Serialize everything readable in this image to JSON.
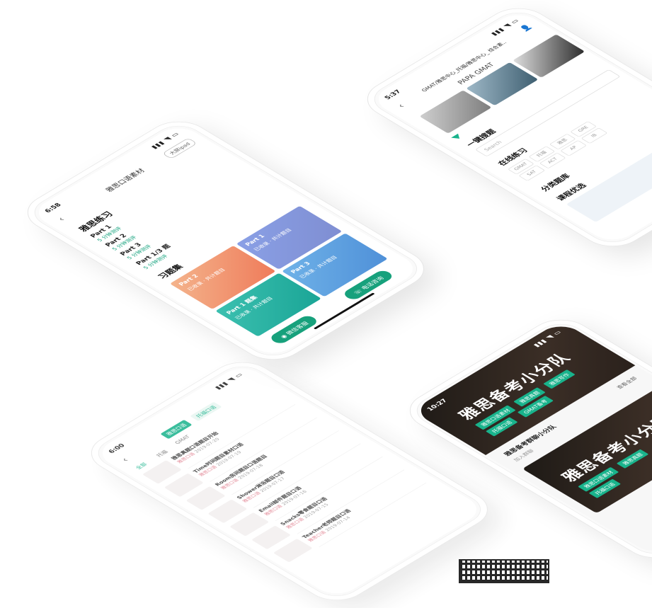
{
  "phone1": {
    "time": "6:58",
    "title": "雅思口语素材",
    "header_button": "大屏ipad",
    "section_title": "雅思练习",
    "parts": [
      {
        "name": "Part 1",
        "sub": "5 分钟测评"
      },
      {
        "name": "Part 2",
        "sub": "5 分钟测评"
      },
      {
        "name": "Part 3",
        "sub": "5 分钟测评"
      },
      {
        "name": "Part 1/3 题",
        "sub": "5 分钟测评"
      }
    ],
    "practice_title": "习题集",
    "tiles": [
      {
        "name": "Part 2",
        "desc": "已收录 · 共计题目"
      },
      {
        "name": "Part 1",
        "desc": "已收录 · 共计题目"
      },
      {
        "name": "Part 1 题集",
        "desc": "已收录 · 共计题目"
      },
      {
        "name": "Part 3",
        "desc": "已收录 · 共计题目"
      }
    ],
    "btn_left": "◉ 微信客服",
    "btn_right": "☏ 电话咨询"
  },
  "phone2": {
    "time": "5:37",
    "breadcrumb": "GMAT/雅思中心_托福/雅思中心_ 综合素..",
    "brand": "PAPA GMAT",
    "section1": "一键搜题",
    "search_placeholder": "Search",
    "section2": "在线练习",
    "chips": [
      "GMAT",
      "托福",
      "雅思",
      "GRE",
      "SAT",
      "ACT",
      "AP",
      "IB"
    ],
    "section3": "分类题库",
    "section4": "课程优选"
  },
  "phone3": {
    "time": "6:00",
    "tab_active": "雅思口语",
    "tab_second": "托福口语",
    "subtabs": [
      "全部",
      "托福",
      "GMAT"
    ],
    "rows": [
      {
        "title": "雅思真题口语题目开始",
        "tag": "雅思口语",
        "meta": "2019-07-20"
      },
      {
        "title": "Time时间题目素材口语",
        "tag": "雅思口语",
        "meta": "2019-07-19"
      },
      {
        "title": "Room房间题目口语题目",
        "tag": "雅思口语",
        "meta": "2019-07-18"
      },
      {
        "title": "Shower淋浴题目口语",
        "tag": "雅思口语",
        "meta": "2019-07-17"
      },
      {
        "title": "Email邮件题目口语",
        "tag": "雅思口语",
        "meta": "2019-07-16"
      },
      {
        "title": "Snacks零食题目口语",
        "tag": "雅思口语",
        "meta": "2019-07-15"
      },
      {
        "title": "Teacher老师题目口语",
        "tag": "雅思口语",
        "meta": "2019-07-14"
      }
    ]
  },
  "phone4": {
    "time": "10:27",
    "banner_title": "雅思备考小分队",
    "tags": [
      "雅思口语素材",
      "雅思真题",
      "雅思写作",
      "托福口语",
      "GMAT备考"
    ],
    "group_name": "雅思备考群聊小分队",
    "group_sub": "加入群聊",
    "group_btn": "查看全部",
    "banner2_title": "雅思备考小分队"
  },
  "qr_label": "QR code"
}
